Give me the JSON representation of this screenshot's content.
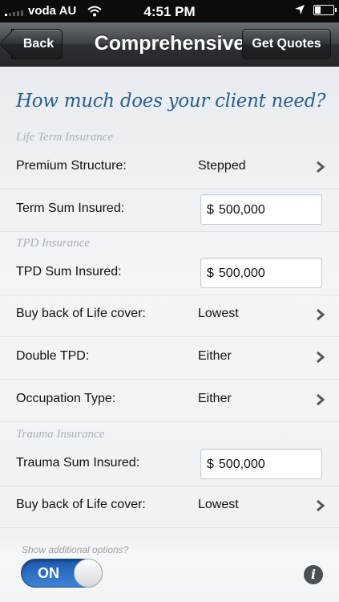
{
  "status_bar": {
    "carrier": "voda AU",
    "time": "4:51 PM",
    "icons": [
      "signal-icon",
      "wifi-icon",
      "location-arrow-icon",
      "battery-icon"
    ]
  },
  "nav": {
    "back_label": "Back",
    "title": "Comprehensive",
    "quotes_label": "Get Quotes"
  },
  "heading": "How much does your client need?",
  "sections": {
    "life": "Life Term Insurance",
    "tpd": "TPD Insurance",
    "trauma": "Trauma Insurance"
  },
  "rows": {
    "premium_structure": {
      "label": "Premium Structure:",
      "value": "Stepped"
    },
    "term_sum": {
      "label": "Term Sum Insured:",
      "currency": "$",
      "value": "500,000"
    },
    "tpd_sum": {
      "label": "TPD Sum Insured:",
      "currency": "$",
      "value": "500,000"
    },
    "tpd_buyback": {
      "label": "Buy back of Life cover:",
      "value": "Lowest"
    },
    "double_tpd": {
      "label": "Double TPD:",
      "value": "Either"
    },
    "occupation": {
      "label": "Occupation Type:",
      "value": "Either"
    },
    "trauma_sum": {
      "label": "Trauma Sum Insured:",
      "currency": "$",
      "value": "500,000"
    },
    "trauma_buyback": {
      "label": "Buy back of Life cover:",
      "value": "Lowest"
    }
  },
  "bottom": {
    "show_options": "Show additional options?",
    "toggle_state": "ON",
    "info_glyph": "i"
  },
  "colors": {
    "heading": "#2a5f8f",
    "toggle_on": "#2f74c8",
    "nav_bg": "#33373b"
  }
}
